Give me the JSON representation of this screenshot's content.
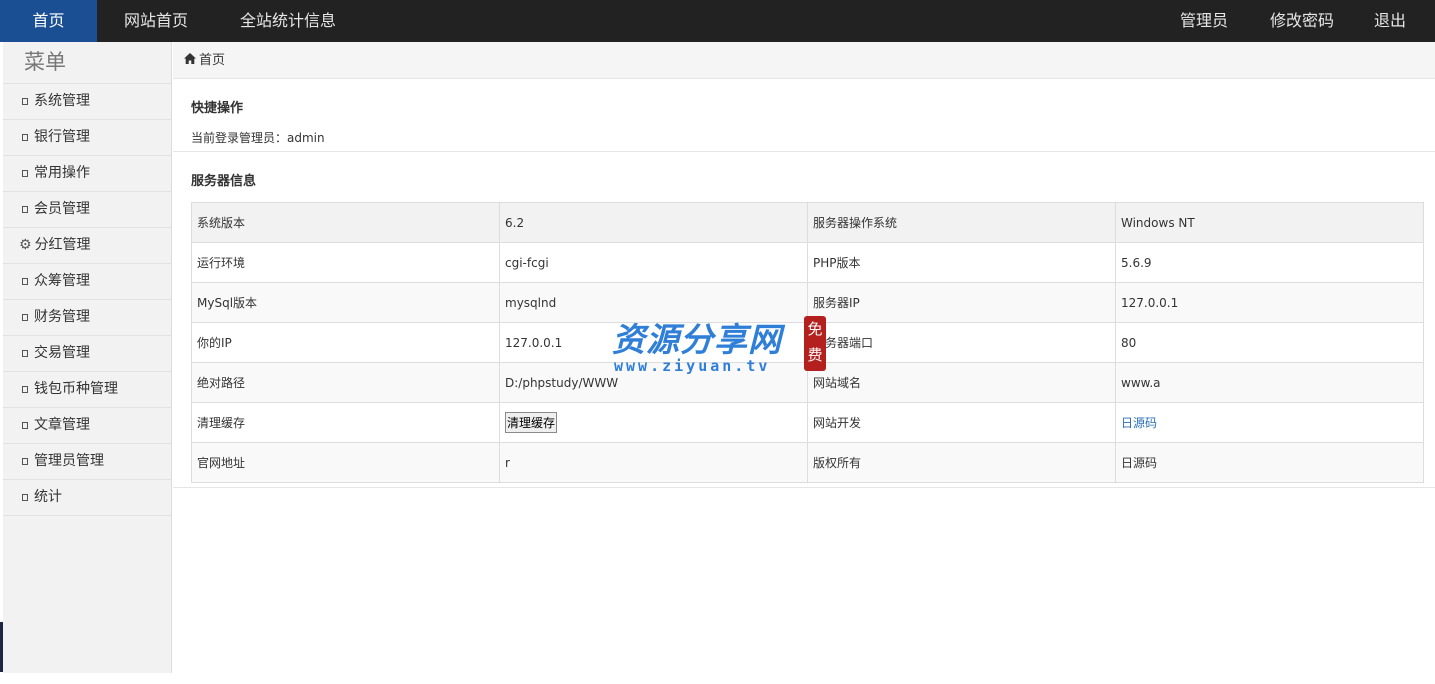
{
  "topbar": {
    "nav_left": [
      "首页",
      "网站首页",
      "全站统计信息"
    ],
    "nav_right": [
      "管理员",
      "修改密码",
      "退出"
    ]
  },
  "sidebar": {
    "title": "菜单",
    "items": [
      {
        "label": "系统管理",
        "icon": "square-icon"
      },
      {
        "label": "银行管理",
        "icon": "square-icon"
      },
      {
        "label": "常用操作",
        "icon": "square-icon"
      },
      {
        "label": "会员管理",
        "icon": "square-icon"
      },
      {
        "label": "分红管理",
        "icon": "gear-icon"
      },
      {
        "label": "众筹管理",
        "icon": "square-icon"
      },
      {
        "label": "财务管理",
        "icon": "square-icon"
      },
      {
        "label": "交易管理",
        "icon": "square-icon"
      },
      {
        "label": "钱包币种管理",
        "icon": "square-icon"
      },
      {
        "label": "文章管理",
        "icon": "square-icon"
      },
      {
        "label": "管理员管理",
        "icon": "square-icon"
      },
      {
        "label": "统计",
        "icon": "square-icon"
      }
    ]
  },
  "breadcrumb": {
    "icon": "home-icon",
    "label": "首页"
  },
  "quick": {
    "title": "快捷操作",
    "login_text": "当前登录管理员：admin"
  },
  "server": {
    "title": "服务器信息",
    "rows": [
      [
        "系统版本",
        "6.2",
        "服务器操作系统",
        "Windows NT"
      ],
      [
        "运行环境",
        "cgi-fcgi",
        "PHP版本",
        "5.6.9"
      ],
      [
        "MySql版本",
        "mysqlnd",
        "服务器IP",
        "127.0.0.1"
      ],
      [
        "你的IP",
        "127.0.0.1",
        "服务器端口",
        "80"
      ],
      [
        "绝对路径",
        "D:/phpstudy/WWW",
        "网站域名",
        "www.a"
      ],
      [
        "清理缓存",
        "清理缓存",
        "网站开发",
        "日源码"
      ],
      [
        "官网地址",
        "r",
        "版权所有",
        "日源码"
      ]
    ]
  },
  "watermark": {
    "text": "资源分享网",
    "url": "www.ziyuan.tv",
    "seal": "免费"
  },
  "colors": {
    "topbar": "#222222",
    "active_nav": "#1b4f94",
    "link": "#2a6fb5"
  }
}
